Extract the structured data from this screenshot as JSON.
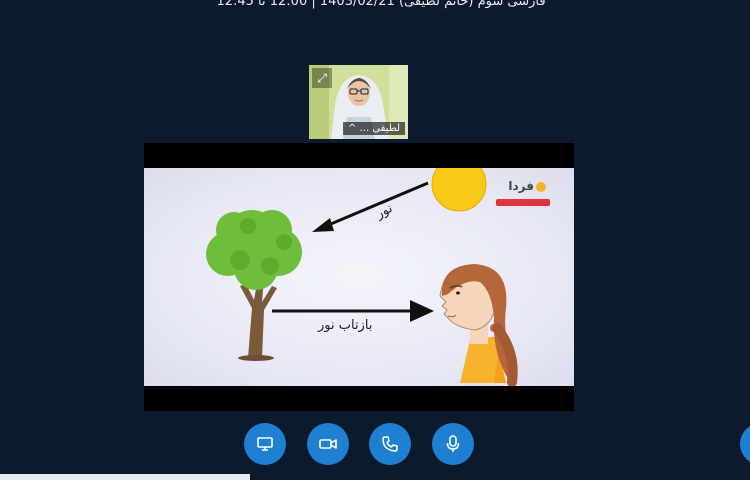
{
  "header": {
    "title": "فارسی سوم (خانم لطیفی) 1403/02/21 | 12:00 تا 12:45"
  },
  "participant": {
    "name": "لطیفی ...",
    "caret": "^",
    "expand_icon": "expand-icon"
  },
  "slide": {
    "brand_text": "فردا",
    "arrow_label_1": "نور",
    "arrow_label_2": "بازتاب نور",
    "colors": {
      "sun": "#f9c918",
      "tree_leaves": "#6fbe3b",
      "trunk": "#7a5a3a",
      "arrow": "#111111",
      "brand_red": "#e2323b"
    }
  },
  "controls": {
    "buttons": [
      {
        "icon": "screen-share-icon"
      },
      {
        "icon": "camera-icon"
      },
      {
        "icon": "phone-icon"
      },
      {
        "icon": "microphone-icon"
      }
    ],
    "color": "#1f7fd1"
  }
}
